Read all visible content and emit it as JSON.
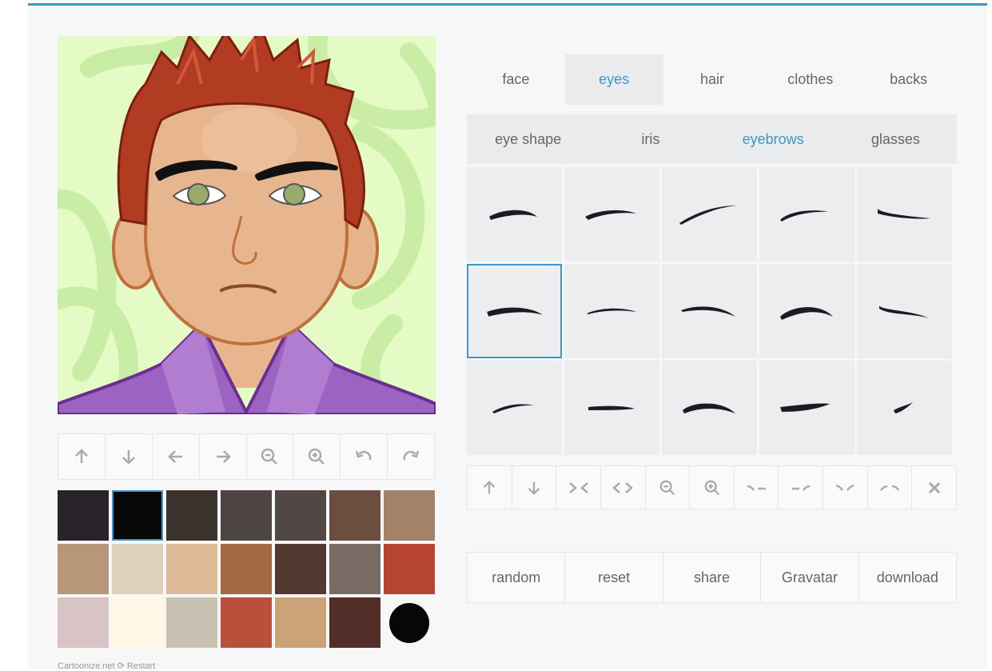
{
  "tabs": [
    {
      "label": "face",
      "active": false
    },
    {
      "label": "eyes",
      "active": true
    },
    {
      "label": "hair",
      "active": false
    },
    {
      "label": "clothes",
      "active": false
    },
    {
      "label": "backs",
      "active": false
    }
  ],
  "subtabs": [
    {
      "label": "eye shape",
      "active": false
    },
    {
      "label": "iris",
      "active": false
    },
    {
      "label": "eyebrows",
      "active": true
    },
    {
      "label": "glasses",
      "active": false
    }
  ],
  "position_controls": [
    "arrow-up-icon",
    "arrow-down-icon",
    "arrow-left-icon",
    "arrow-right-icon",
    "zoom-out-icon",
    "zoom-in-icon",
    "rotate-left-icon",
    "rotate-right-icon"
  ],
  "feature_controls": [
    "arrow-up-icon",
    "arrow-down-icon",
    "move-closer-icon",
    "move-apart-icon",
    "zoom-out-icon",
    "zoom-in-icon",
    "tilt-1-icon",
    "tilt-2-icon",
    "tilt-3-icon",
    "tilt-4-icon",
    "remove-icon"
  ],
  "colors": {
    "accent": "#3d97cc",
    "selected_swatch": "#070707",
    "swatches": [
      "#29232b",
      "#070707",
      "#3b322c",
      "#4d4543",
      "#514845",
      "#6b4e3f",
      "#a3826a",
      "#b8967a",
      "#dfd0bb",
      "#dfba97",
      "#a46a46",
      "#533a31",
      "#786b63",
      "#b74430",
      "#d8c3c5",
      "#fff8e7",
      "#c9c1b2",
      "#b9503b",
      "#cca378",
      "#512f28",
      "#070707"
    ]
  },
  "eyebrow_options": {
    "count": 15,
    "selected_index": 5
  },
  "actions": [
    "random",
    "reset",
    "share",
    "Gravatar",
    "download"
  ],
  "footer": {
    "text": "Cartoonize.net",
    "restart_label": "Restart"
  }
}
